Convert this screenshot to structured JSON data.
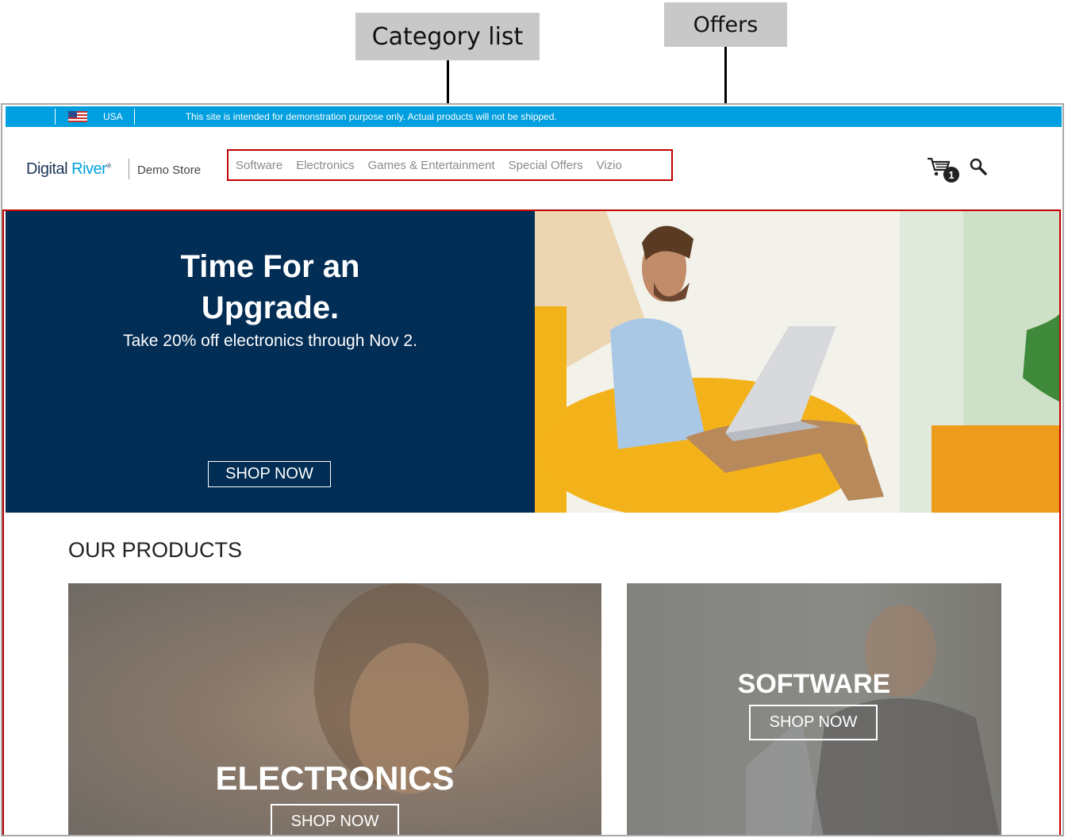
{
  "annotations": {
    "category_list": "Category list",
    "offers": "Offers"
  },
  "topbar": {
    "country": "USA",
    "notice": "This site is intended for demonstration purpose only. Actual products will not be shipped."
  },
  "header": {
    "brand_dark": "Digital",
    "brand_accent": "River",
    "brand_mark": "®",
    "store_name": "Demo Store",
    "nav": [
      "Software",
      "Electronics",
      "Games & Entertainment",
      "Special Offers",
      "Vizio"
    ],
    "cart_count": "1"
  },
  "hero": {
    "title_line1": "Time For an",
    "title_line2": "Upgrade.",
    "subtitle": "Take 20% off electronics through Nov 2.",
    "button": "SHOP NOW"
  },
  "products": {
    "title": "OUR PRODUCTS",
    "cards": [
      {
        "label": "ELECTRONICS",
        "button": "SHOP NOW"
      },
      {
        "label": "SOFTWARE",
        "button": "SHOP NOW"
      }
    ]
  },
  "colors": {
    "topbar": "#009fdf",
    "hero": "#022d55",
    "highlight": "#c00000"
  }
}
